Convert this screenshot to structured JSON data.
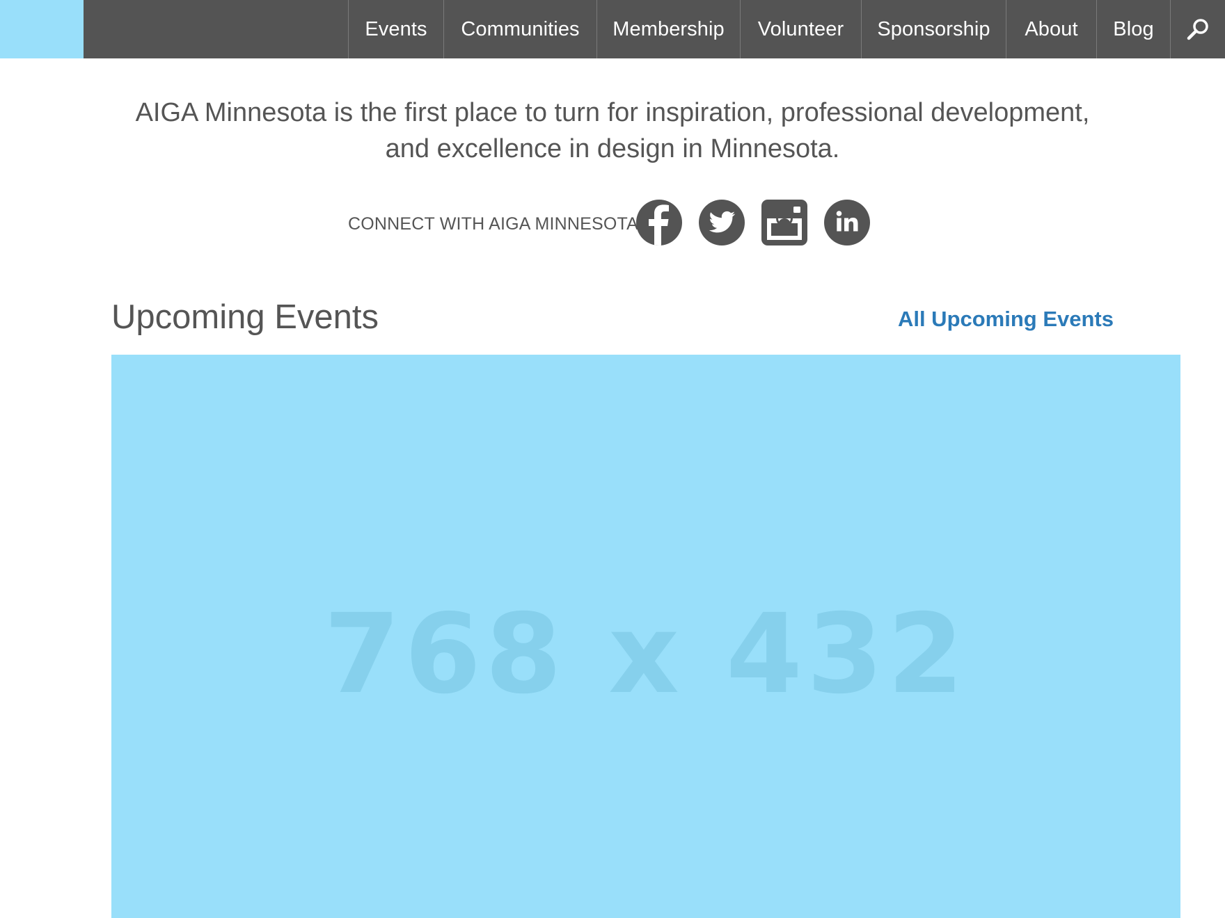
{
  "header": {
    "logo_color": "#99dffa",
    "bar_color": "#545454",
    "nav": [
      {
        "label": "Events"
      },
      {
        "label": "Communities"
      },
      {
        "label": "Membership"
      },
      {
        "label": "Volunteer"
      },
      {
        "label": "Sponsorship"
      },
      {
        "label": "About"
      },
      {
        "label": "Blog"
      }
    ],
    "search_icon": "search-icon"
  },
  "intro": {
    "line1": "AIGA Minnesota is the first place to turn for inspiration, professional development,",
    "line2": "and excellence in design in Minnesota."
  },
  "connect": {
    "label": "CONNECT WITH AIGA MINNESOTA",
    "icons": [
      "facebook-icon",
      "twitter-icon",
      "instagram-icon",
      "linkedin-icon"
    ],
    "icon_color": "#545454"
  },
  "events": {
    "title": "Upcoming Events",
    "all_link": "All Upcoming Events",
    "link_color": "#2b7ab8",
    "image_placeholder": "768 x 432",
    "image_color": "#99dffa"
  }
}
